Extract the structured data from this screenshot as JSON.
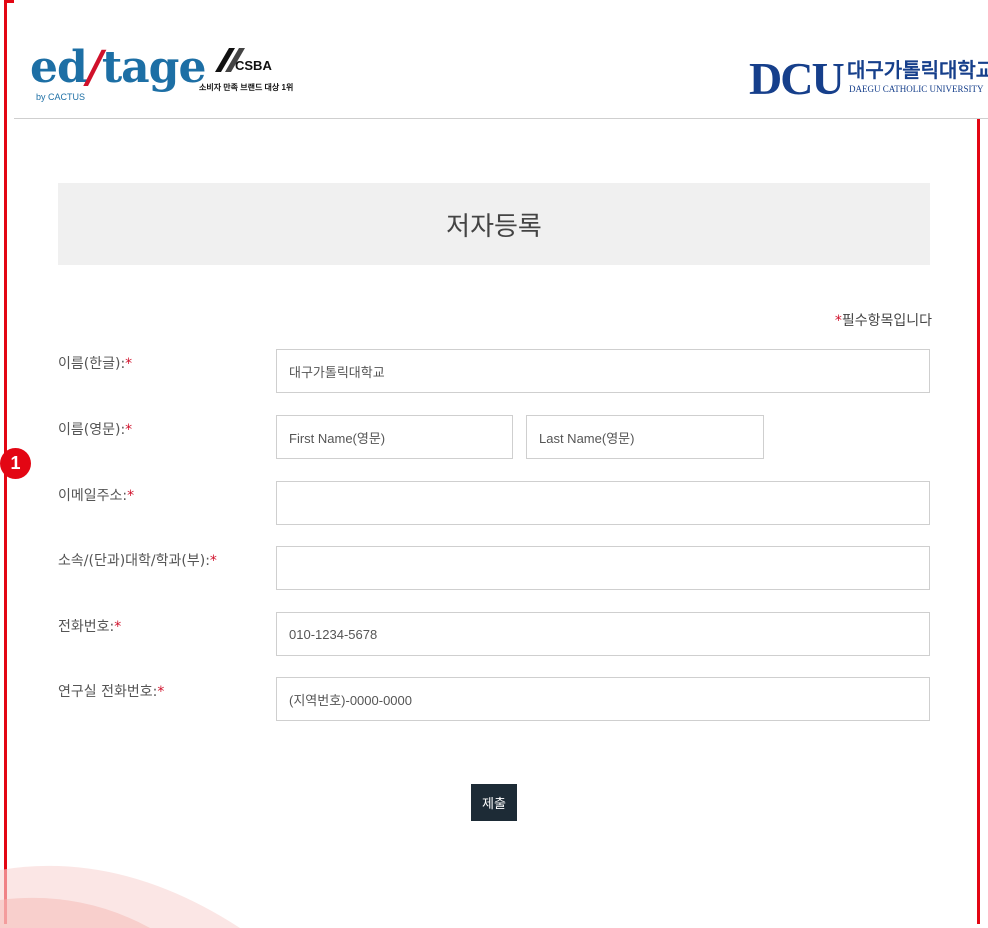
{
  "header": {
    "editage_logo": {
      "main_left": "ed",
      "slash": "/",
      "main_right": "tage",
      "sub": "by CACTUS"
    },
    "csba_badge": {
      "mark": "CSBA",
      "caption": "소비자 만족 브랜드 대상 1위"
    },
    "dcu_logo": {
      "mark": "DCU",
      "name": "대구가톨릭대학교",
      "english": "DAEGU CATHOLIC UNIVERSITY"
    }
  },
  "page_title": "저자등록",
  "required_note": "필수항목입니다",
  "required_marker": "*",
  "form": {
    "name_korean": {
      "label": "이름(한글):",
      "value": "대구가톨릭대학교"
    },
    "name_english": {
      "label": "이름(영문):",
      "first_placeholder": "First Name(영문)",
      "last_placeholder": "Last Name(영문)"
    },
    "email": {
      "label": "이메일주소:",
      "value": ""
    },
    "affiliation": {
      "label": "소속/(단과)대학/학과(부):",
      "value": ""
    },
    "phone": {
      "label": "전화번호:",
      "placeholder": "010-1234-5678"
    },
    "lab_phone": {
      "label": "연구실 전화번호:",
      "placeholder": "(지역번호)-0000-0000"
    },
    "submit_label": "제출"
  },
  "annotation_badge": "1",
  "colors": {
    "frame": "#e30613",
    "brand_blue": "#1d6fa5",
    "dcu_blue": "#163f8b",
    "button": "#1d2b36"
  }
}
